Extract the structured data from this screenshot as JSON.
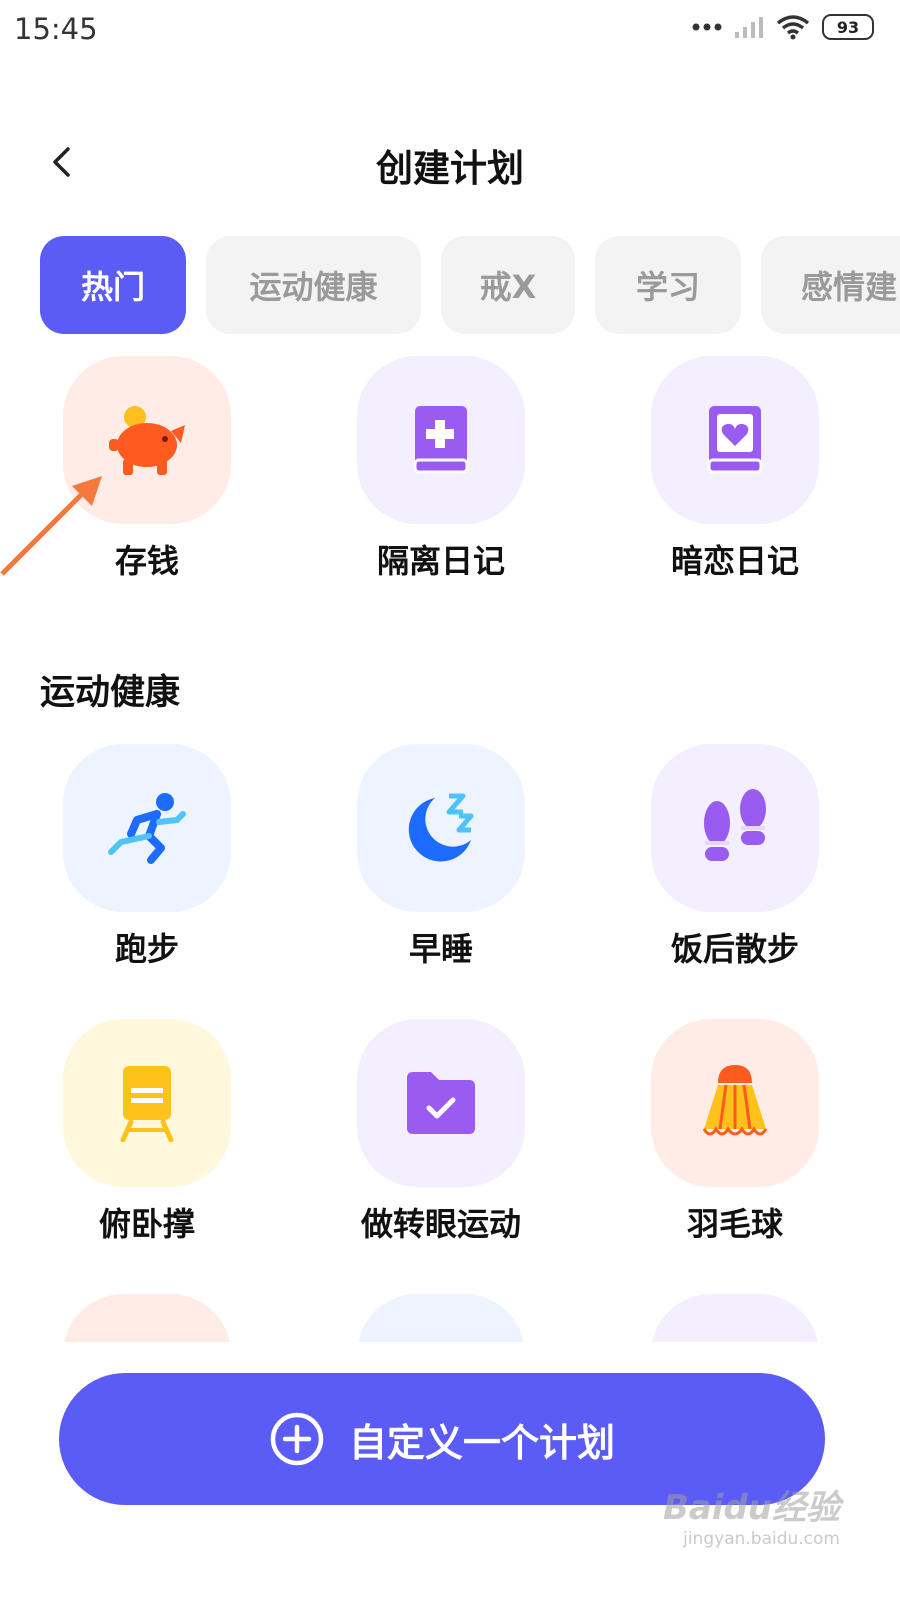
{
  "status": {
    "time": "15:45",
    "battery": "93"
  },
  "header": {
    "title": "创建计划"
  },
  "tabs": [
    {
      "label": "热门"
    },
    {
      "label": "运动健康"
    },
    {
      "label": "戒X"
    },
    {
      "label": "学习"
    },
    {
      "label": "感情建"
    }
  ],
  "hot_items": [
    {
      "label": "存钱",
      "icon": "piggy-bank-icon"
    },
    {
      "label": "隔离日记",
      "icon": "medical-diary-icon"
    },
    {
      "label": "暗恋日记",
      "icon": "heart-diary-icon"
    }
  ],
  "sports_section": {
    "title": "运动健康",
    "items": [
      {
        "label": "跑步",
        "icon": "running-icon"
      },
      {
        "label": "早睡",
        "icon": "moon-sleep-icon"
      },
      {
        "label": "饭后散步",
        "icon": "footprints-icon"
      },
      {
        "label": "俯卧撑",
        "icon": "train-icon"
      },
      {
        "label": "做转眼运动",
        "icon": "folder-check-icon"
      },
      {
        "label": "羽毛球",
        "icon": "shuttlecock-icon"
      }
    ]
  },
  "cta": {
    "label": "自定义一个计划"
  },
  "watermark": {
    "logo": "Baidu经验",
    "url": "jingyan.baidu.com"
  },
  "colors": {
    "accent": "#5b5bf5",
    "annotation_arrow": "#f4793b"
  }
}
